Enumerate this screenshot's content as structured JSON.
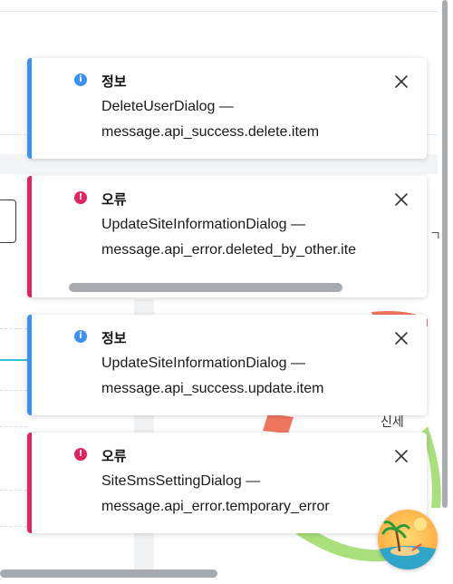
{
  "toasts": [
    {
      "type": "info",
      "title": "정보",
      "line1": "DeleteUserDialog —",
      "line2": "message.api_success.delete.item"
    },
    {
      "type": "error",
      "title": "오류",
      "line1": "UpdateSiteInformationDialog —",
      "line2": "message.api_error.deleted_by_other.ite"
    },
    {
      "type": "info",
      "title": "정보",
      "line1": "UpdateSiteInformationDialog —",
      "line2": "message.api_success.update.item"
    },
    {
      "type": "error",
      "title": "오류",
      "line1": "SiteSmsSettingDialog —",
      "line2": "message.api_error.temporary_error"
    }
  ],
  "background": {
    "partial_text_right": "ㄱ",
    "chart_label": "신세"
  },
  "colors": {
    "info": "#3b91f5",
    "error": "#e0245e",
    "chart_orange": "#f0775e",
    "chart_green": "#9bd86a",
    "accent_teal": "#35c1d6"
  },
  "icons": {
    "info": "info-icon",
    "error": "error-icon",
    "close": "close-icon",
    "avatar": "beach-island-avatar"
  }
}
